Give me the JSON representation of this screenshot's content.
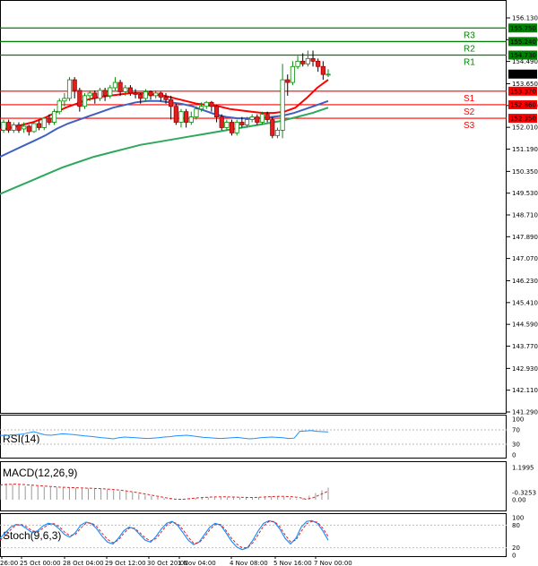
{
  "chart_data": {
    "type": "candlestick",
    "instrument_note": "",
    "price_axis": {
      "ticks": [
        "156.130",
        "155.310",
        "154.490",
        "153.650",
        "152.830",
        "152.010",
        "151.190",
        "150.350",
        "149.530",
        "148.710",
        "147.890",
        "147.070",
        "146.230",
        "145.410",
        "144.590",
        "143.770",
        "142.930",
        "142.110",
        "141.290"
      ],
      "ylim": [
        141.29,
        156.13
      ]
    },
    "x_ticks": [
      "26:00",
      "25 Oct 00:00",
      "28 Oct 04:00",
      "29 Oct 12:00",
      "30 Oct 20:00",
      "1 Nov 04:00",
      "4 Nov 08:00",
      "5 Nov 16:00",
      "7 Nov 00:00"
    ],
    "levels": [
      {
        "name": "R3",
        "value": 155.75,
        "color": "#008000",
        "tag": "155.750"
      },
      {
        "name": "R2",
        "value": 155.24,
        "color": "#008000",
        "tag": "155.240"
      },
      {
        "name": "R1",
        "value": 154.73,
        "color": "#008000",
        "tag": "154.730"
      },
      {
        "name": "S1",
        "value": 153.37,
        "color": "#ff0000",
        "tag": "153.370"
      },
      {
        "name": "S2",
        "value": 152.86,
        "color": "#ff0000",
        "tag": "152.860"
      },
      {
        "name": "S3",
        "value": 152.35,
        "color": "#ff0000",
        "tag": "152.350"
      }
    ],
    "current_price": {
      "value": 154.014,
      "tag": "154.014"
    },
    "candles": [
      [
        151.9,
        152.2,
        152.3,
        151.8
      ],
      [
        152.2,
        151.9,
        152.3,
        151.8
      ],
      [
        151.9,
        152.1,
        152.2,
        151.8
      ],
      [
        152.1,
        151.9,
        152.2,
        151.8
      ],
      [
        151.95,
        152.05,
        152.2,
        151.8
      ],
      [
        152.05,
        151.85,
        152.1,
        151.7
      ],
      [
        151.85,
        152.15,
        152.2,
        151.8
      ],
      [
        152.15,
        152.0,
        152.3,
        151.9
      ],
      [
        152.0,
        152.35,
        152.4,
        151.9
      ],
      [
        152.35,
        152.2,
        152.5,
        152.1
      ],
      [
        152.2,
        152.6,
        152.7,
        152.1
      ],
      [
        152.6,
        153.0,
        153.1,
        152.5
      ],
      [
        153.0,
        153.1,
        153.3,
        152.8
      ],
      [
        153.1,
        153.8,
        153.9,
        153.0
      ],
      [
        153.8,
        153.4,
        153.9,
        153.1
      ],
      [
        153.4,
        152.8,
        153.5,
        152.6
      ],
      [
        152.8,
        153.2,
        153.3,
        152.7
      ],
      [
        153.2,
        153.3,
        153.4,
        153.0
      ],
      [
        153.3,
        153.1,
        153.4,
        152.9
      ],
      [
        153.1,
        153.4,
        153.5,
        153.0
      ],
      [
        153.4,
        153.2,
        153.5,
        153.0
      ],
      [
        153.2,
        153.5,
        153.6,
        153.1
      ],
      [
        153.5,
        153.7,
        153.9,
        153.4
      ],
      [
        153.7,
        153.35,
        153.8,
        153.2
      ],
      [
        153.35,
        153.5,
        153.6,
        153.2
      ],
      [
        153.5,
        153.3,
        153.6,
        153.2
      ],
      [
        153.3,
        153.25,
        153.45,
        153.1
      ],
      [
        153.25,
        153.1,
        153.3,
        152.9
      ],
      [
        153.1,
        153.35,
        153.45,
        153.0
      ],
      [
        153.35,
        153.2,
        153.4,
        153.05
      ],
      [
        153.2,
        153.3,
        153.4,
        153.1
      ],
      [
        153.3,
        153.15,
        153.35,
        153.0
      ],
      [
        153.15,
        153.05,
        153.3,
        152.9
      ],
      [
        153.05,
        152.8,
        153.2,
        152.3
      ],
      [
        152.8,
        152.2,
        152.9,
        152.1
      ],
      [
        152.2,
        152.6,
        152.7,
        152.0
      ],
      [
        152.6,
        152.2,
        152.7,
        152.0
      ],
      [
        152.2,
        152.4,
        152.6,
        152.1
      ],
      [
        152.4,
        152.7,
        152.8,
        152.3
      ],
      [
        152.7,
        152.8,
        152.95,
        152.6
      ],
      [
        152.8,
        152.95,
        153.0,
        152.7
      ],
      [
        152.95,
        152.8,
        153.0,
        152.6
      ],
      [
        152.8,
        152.4,
        152.85,
        152.2
      ],
      [
        152.4,
        152.0,
        152.5,
        151.9
      ],
      [
        152.0,
        152.2,
        152.3,
        151.9
      ],
      [
        152.2,
        151.8,
        152.3,
        151.7
      ],
      [
        151.8,
        152.2,
        152.3,
        151.7
      ],
      [
        152.2,
        152.1,
        152.4,
        152.0
      ],
      [
        152.1,
        152.3,
        152.4,
        152.0
      ],
      [
        152.3,
        152.4,
        152.5,
        152.2
      ],
      [
        152.4,
        152.2,
        152.5,
        152.1
      ],
      [
        152.2,
        152.5,
        152.6,
        152.1
      ],
      [
        152.5,
        152.3,
        152.6,
        152.2
      ],
      [
        152.3,
        151.7,
        152.4,
        151.6
      ],
      [
        151.7,
        151.9,
        152.0,
        151.6
      ],
      [
        151.9,
        153.8,
        154.4,
        151.6
      ],
      [
        153.8,
        153.7,
        154.0,
        153.2
      ],
      [
        153.7,
        154.3,
        154.5,
        153.6
      ],
      [
        154.3,
        154.5,
        154.7,
        154.2
      ],
      [
        154.5,
        154.4,
        154.8,
        154.3
      ],
      [
        154.4,
        154.6,
        154.9,
        154.3
      ],
      [
        154.6,
        154.5,
        154.9,
        154.3
      ],
      [
        154.5,
        154.3,
        154.6,
        154.1
      ],
      [
        154.3,
        154.0,
        154.5,
        153.8
      ],
      [
        154.0,
        154.01,
        154.2,
        153.9
      ]
    ],
    "ma_series": [
      {
        "color": "#ff0000",
        "values": [
          151.9,
          152.0,
          152.1,
          152.2,
          152.35,
          152.55,
          152.75,
          152.9,
          153.05,
          153.15,
          153.2,
          153.25,
          153.3,
          153.3,
          153.25,
          153.2,
          153.1,
          153.0,
          152.9,
          152.85,
          152.8,
          152.7,
          152.65,
          152.6,
          152.55,
          152.55,
          152.6,
          152.75,
          153.1,
          153.5,
          153.8
        ]
      },
      {
        "color": "#4060c0",
        "values": [
          150.9,
          151.1,
          151.3,
          151.5,
          151.7,
          151.95,
          152.15,
          152.3,
          152.45,
          152.6,
          152.75,
          152.85,
          152.95,
          153.0,
          153.0,
          152.95,
          152.9,
          152.8,
          152.65,
          152.5,
          152.4,
          152.35,
          152.35,
          152.35,
          152.4,
          152.45,
          152.55,
          152.7,
          152.85,
          153.0
        ]
      },
      {
        "color": "#2ea85a",
        "values": [
          149.5,
          149.75,
          150.0,
          150.25,
          150.5,
          150.7,
          150.9,
          151.05,
          151.2,
          151.35,
          151.45,
          151.55,
          151.65,
          151.75,
          151.85,
          151.95,
          152.05,
          152.15,
          152.25,
          152.4,
          152.55,
          152.75
        ]
      }
    ],
    "indicators": [
      {
        "name": "RSI(14)",
        "ticks": [
          "100",
          "70",
          "30",
          "0"
        ],
        "values": [
          55,
          54,
          56,
          57,
          58,
          62,
          65,
          60,
          56,
          55,
          57,
          59,
          58,
          57,
          55,
          53,
          52,
          50,
          48,
          47,
          45,
          48,
          50,
          49,
          48,
          47,
          46,
          47,
          48,
          50,
          51,
          53,
          54,
          55,
          53,
          51,
          49,
          48,
          47,
          46,
          47,
          48,
          49,
          47,
          45,
          46,
          48,
          49,
          50,
          49,
          48,
          46,
          47,
          66,
          67,
          68,
          66,
          65,
          64
        ]
      },
      {
        "name": "MACD(12,26,9)",
        "ticks": [
          "1.1995",
          "0.00",
          "-0.3253"
        ],
        "bars": [
          0.55,
          0.6,
          0.58,
          0.55,
          0.5,
          0.52,
          0.5,
          0.48,
          0.47,
          0.46,
          0.45,
          0.45,
          0.44,
          0.43,
          0.42,
          0.41,
          0.4,
          0.38,
          0.35,
          0.32,
          0.3,
          0.28,
          0.22,
          0.18,
          0.14,
          0.1,
          0.06,
          0.03,
          0.0,
          -0.02,
          -0.05,
          -0.07,
          -0.09,
          -0.1,
          -0.11,
          -0.12,
          -0.11,
          -0.12,
          -0.1,
          -0.08,
          -0.1,
          -0.12,
          -0.14,
          -0.16,
          -0.15,
          -0.13,
          -0.1,
          -0.05,
          0.05,
          0.15,
          0.25,
          0.35,
          0.45
        ],
        "signal": [
          0.55,
          0.57,
          0.58,
          0.57,
          0.55,
          0.53,
          0.51,
          0.49,
          0.47,
          0.46,
          0.45,
          0.44,
          0.43,
          0.42,
          0.41,
          0.39,
          0.37,
          0.34,
          0.3,
          0.26,
          0.21,
          0.16,
          0.11,
          0.06,
          0.02,
          -0.02,
          -0.05,
          -0.08,
          -0.1,
          -0.12,
          -0.13,
          -0.13,
          -0.12,
          -0.11,
          -0.1,
          -0.1,
          -0.12,
          -0.14,
          -0.15,
          -0.15,
          -0.14,
          -0.1,
          -0.02,
          0.08,
          0.2,
          0.32
        ]
      },
      {
        "name": "Stoch(9,6,3)",
        "ticks": [
          "100",
          "80",
          "20",
          "0"
        ],
        "k": [
          45,
          60,
          75,
          82,
          80,
          70,
          60,
          65,
          78,
          85,
          82,
          70,
          55,
          48,
          60,
          80,
          88,
          84,
          70,
          50,
          35,
          30,
          45,
          65,
          75,
          70,
          55,
          40,
          35,
          50,
          70,
          85,
          90,
          80,
          60,
          40,
          28,
          35,
          55,
          75,
          85,
          80,
          60,
          38,
          22,
          15,
          20,
          40,
          65,
          85,
          92,
          88,
          70,
          45,
          30,
          45,
          75,
          90,
          92,
          85,
          65,
          40
        ]
      },
      {
        "name": "",
        "k2": [
          40,
          52,
          68,
          80,
          82,
          75,
          65,
          62,
          72,
          82,
          84,
          76,
          62,
          52,
          55,
          72,
          85,
          86,
          76,
          58,
          42,
          33,
          40,
          58,
          72,
          72,
          60,
          46,
          38,
          44,
          62,
          80,
          88,
          84,
          68,
          48,
          32,
          33,
          48,
          68,
          82,
          82,
          66,
          46,
          30,
          20,
          20,
          33,
          55,
          78,
          90,
          90,
          76,
          54,
          36,
          40,
          64,
          84,
          90,
          88,
          72,
          50
        ]
      }
    ]
  }
}
